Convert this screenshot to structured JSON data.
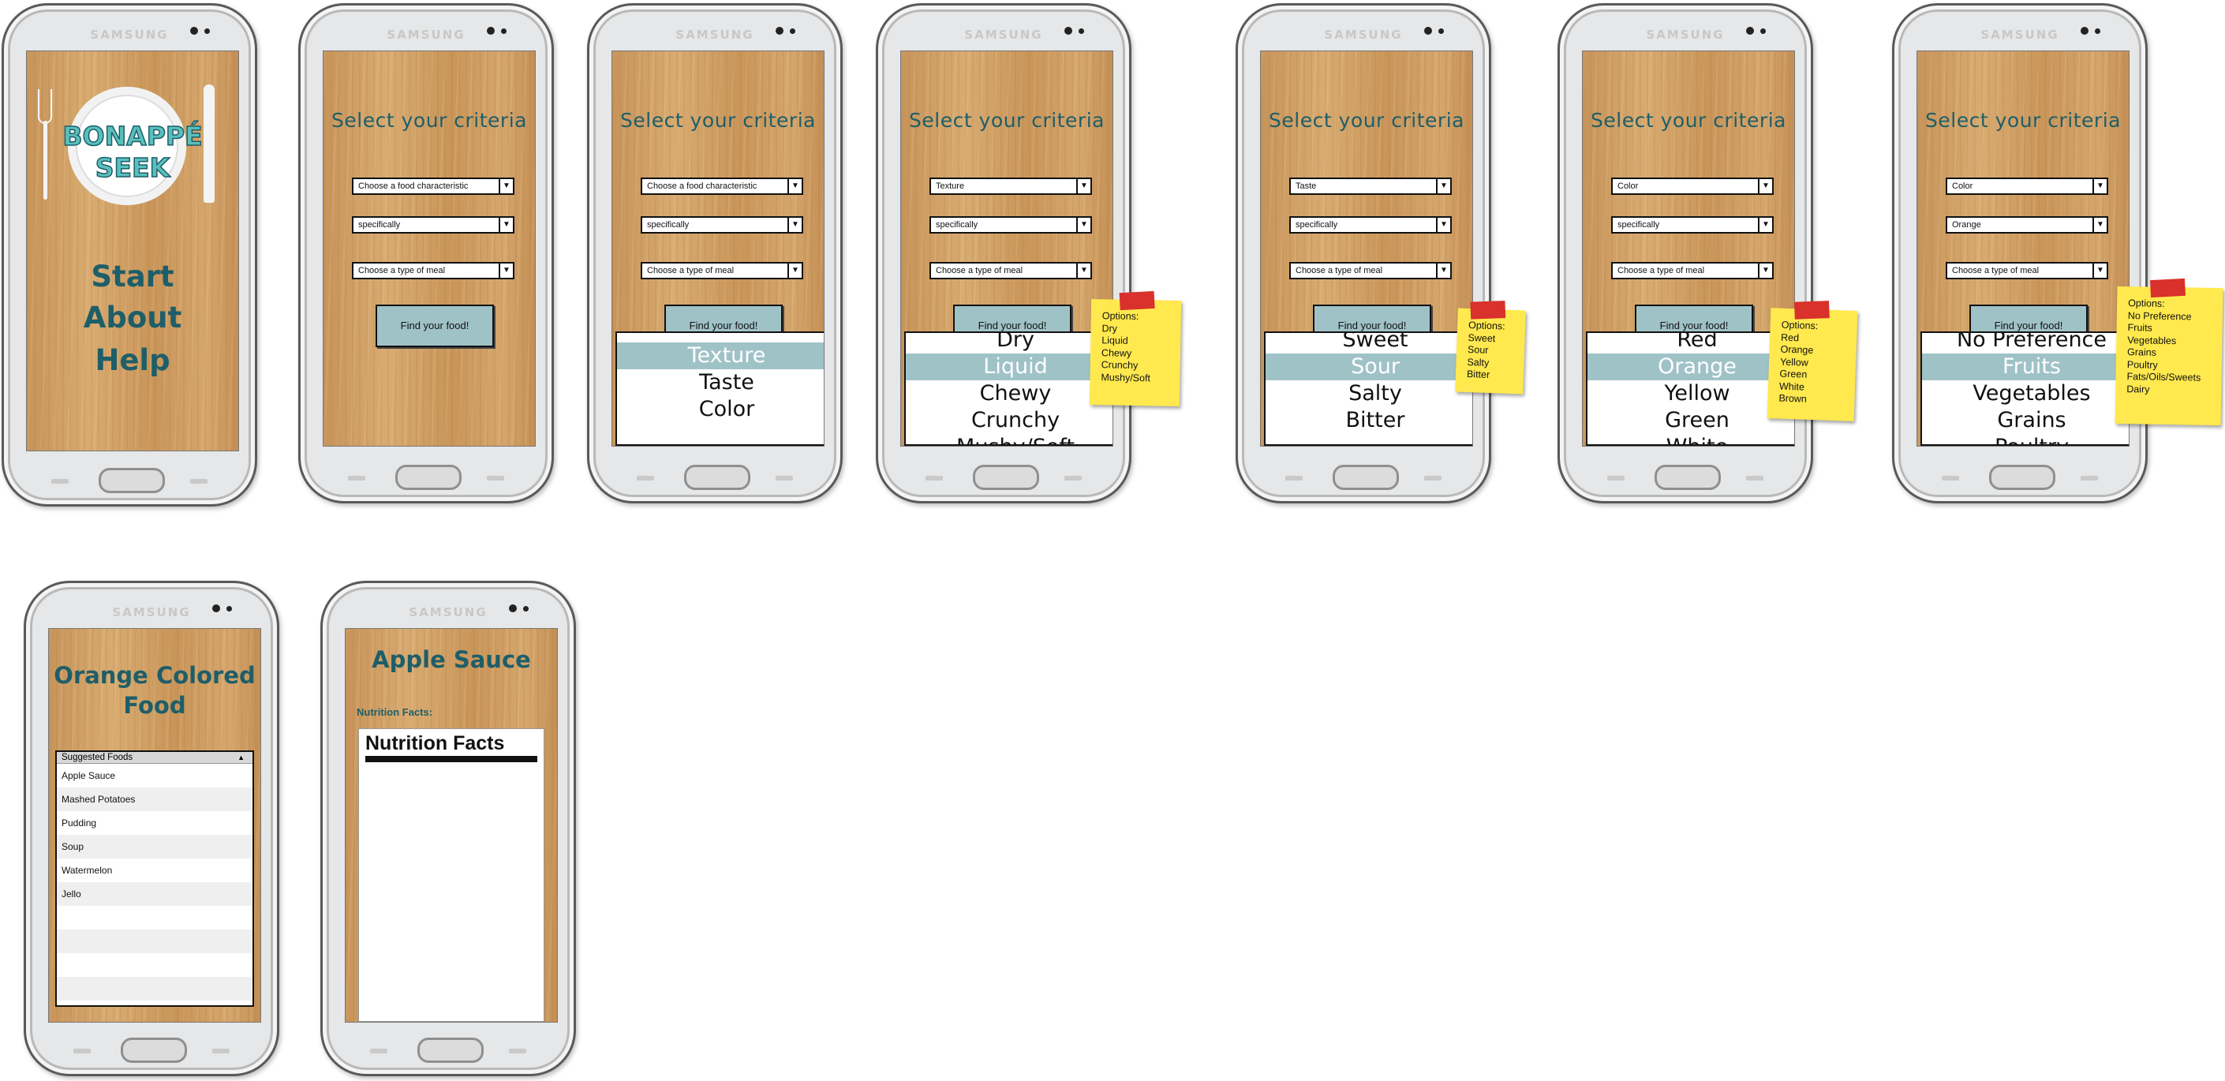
{
  "app": {
    "logo_line1": "BONAPPÉ",
    "logo_line2": "SEEK",
    "brand": "SAMSUNG"
  },
  "home": {
    "menu": [
      "Start",
      "About",
      "Help"
    ]
  },
  "criteria": {
    "title": "Select your criteria",
    "find_button": "Find your food!",
    "characteristic_placeholder": "Choose a food characteristic",
    "specifically_placeholder": "specifically",
    "meal_placeholder": "Choose a type of meal",
    "dropdown_arrow": "▼"
  },
  "screens": {
    "s3": {
      "picker": [
        "",
        "Texture",
        "Taste",
        "Color"
      ],
      "selected": 1
    },
    "s4": {
      "characteristic": "Texture",
      "picker": [
        "Dry",
        "Liquid",
        "Chewy",
        "Crunchy",
        "Mushy/Soft"
      ],
      "selected": 1,
      "note": [
        "Options:",
        "Dry",
        "Liquid",
        "Chewy",
        "Crunchy",
        "Mushy/Soft"
      ]
    },
    "s5": {
      "characteristic": "Taste",
      "picker": [
        "Sweet",
        "Sour",
        "Salty",
        "Bitter"
      ],
      "selected": 1,
      "note": [
        "Options:",
        "Sweet",
        "Sour",
        "Salty",
        "Bitter"
      ]
    },
    "s6": {
      "characteristic": "Color",
      "picker": [
        "Red",
        "Orange",
        "Yellow",
        "Green",
        "White"
      ],
      "selected": 1,
      "note": [
        "Options:",
        "Red",
        "Orange",
        "Yellow",
        "Green",
        "White",
        "Brown"
      ]
    },
    "s7": {
      "characteristic": "Color",
      "specifically": "Orange",
      "picker": [
        "No Preference",
        "Fruits",
        "Vegetables",
        "Grains",
        "Poultry"
      ],
      "selected": 1,
      "note": [
        "Options:",
        "No Preference",
        "Fruits",
        "Vegetables",
        "Grains",
        "Poultry",
        "Fats/Oils/Sweets",
        "Dairy"
      ]
    }
  },
  "results": {
    "title_line1": "Orange Colored",
    "title_line2": "Food",
    "list_header": "Suggested Foods",
    "items": [
      "Apple Sauce",
      "Mashed Potatoes",
      "Pudding",
      "Soup",
      "Watermelon",
      "Jello",
      "",
      "",
      "",
      ""
    ]
  },
  "detail": {
    "title": "Apple Sauce",
    "subtitle": "Nutrition Facts:",
    "label_title": "Nutrition Facts",
    "rows": []
  },
  "colors": {
    "teal": "#1e5e69",
    "selection": "#9fc2c7",
    "note": "#ffe94e",
    "tape": "#d9312b"
  }
}
